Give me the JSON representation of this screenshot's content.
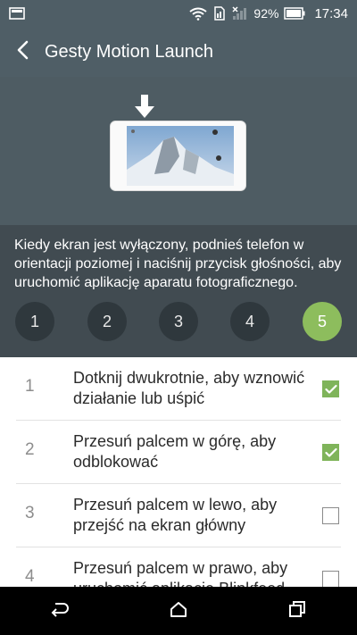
{
  "status_bar": {
    "battery_percent": "92%",
    "time": "17:34",
    "icons": [
      "screenshot-icon",
      "wifi-icon",
      "sim-icon",
      "signal-icon",
      "battery-icon"
    ]
  },
  "app_bar": {
    "title": "Gesty Motion Launch"
  },
  "info": {
    "description": "Kiedy ekran jest wyłączony, podnieś telefon w orientacji poziomej i naciśnij przycisk głośności, aby uruchomić aplikację aparatu fotograficznego."
  },
  "steps": [
    {
      "label": "1",
      "active": false
    },
    {
      "label": "2",
      "active": false
    },
    {
      "label": "3",
      "active": false
    },
    {
      "label": "4",
      "active": false
    },
    {
      "label": "5",
      "active": true
    }
  ],
  "gestures": [
    {
      "number": "1",
      "text": "Dotknij dwukrotnie, aby wznowić działanie lub uśpić",
      "checked": true
    },
    {
      "number": "2",
      "text": "Przesuń palcem w górę, aby odblokować",
      "checked": true
    },
    {
      "number": "3",
      "text": "Przesuń palcem w lewo, aby przejść na ekran główny",
      "checked": false
    },
    {
      "number": "4",
      "text": "Przesuń palcem w prawo, aby uruchomić aplikację Blinkfeed",
      "checked": false
    }
  ],
  "colors": {
    "toolbar": "#4f5e66",
    "info_bg": "#414b51",
    "accent_green": "#8dbd5d",
    "step_bg": "#2f383d"
  }
}
